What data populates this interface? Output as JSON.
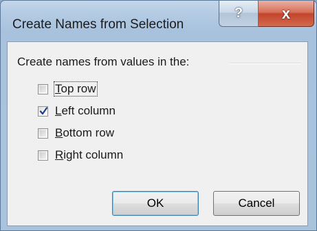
{
  "window": {
    "title": "Create Names from Selection",
    "help_glyph": "?",
    "close_glyph": "x"
  },
  "group": {
    "label": "Create names from values in the:"
  },
  "options": [
    {
      "access_key": "T",
      "rest": "op row",
      "checked": false,
      "focused": true
    },
    {
      "access_key": "L",
      "rest": "eft column",
      "checked": true,
      "focused": false
    },
    {
      "access_key": "B",
      "rest": "ottom row",
      "checked": false,
      "focused": false
    },
    {
      "access_key": "R",
      "rest": "ight column",
      "checked": false,
      "focused": false
    }
  ],
  "buttons": {
    "ok_label": "OK",
    "cancel_label": "Cancel"
  },
  "colors": {
    "close_button": "#c2452c",
    "checkmark": "#1f3d8a"
  }
}
